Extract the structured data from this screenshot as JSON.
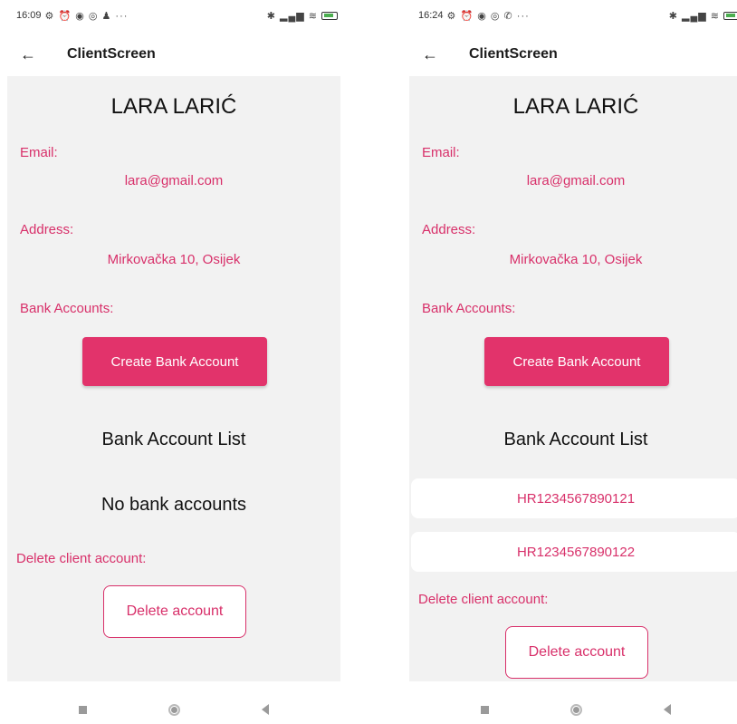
{
  "left_screen": {
    "status": {
      "time": "16:09",
      "left_icons": "⚙ ⏰ ◉ ◎ ♟ ···",
      "right_icons": "✱ ▂▄▆ ≋"
    },
    "app_bar": {
      "back_icon": "←",
      "title": "ClientScreen"
    },
    "client": {
      "name": "LARA LARIĆ",
      "email_label": "Email:",
      "email": "lara@gmail.com",
      "address_label": "Address:",
      "address": "Mirkovačka 10, Osijek",
      "bank_accounts_label": "Bank Accounts:"
    },
    "create_button": "Create Bank Account",
    "list_title": "Bank Account List",
    "empty_text": "No bank accounts",
    "delete_label": "Delete  client account:",
    "delete_button": "Delete account"
  },
  "right_screen": {
    "status": {
      "time": "16:24",
      "left_icons": "⚙ ⏰ ◉ ◎ ✆ ···",
      "right_icons": "✱ ▂▄▆ ≋"
    },
    "app_bar": {
      "back_icon": "←",
      "title": "ClientScreen"
    },
    "client": {
      "name": "LARA LARIĆ",
      "email_label": "Email:",
      "email": "lara@gmail.com",
      "address_label": "Address:",
      "address": "Mirkovačka 10, Osijek",
      "bank_accounts_label": "Bank Accounts:"
    },
    "create_button": "Create Bank Account",
    "list_title": "Bank Account List",
    "accounts": [
      "HR1234567890121",
      "HR1234567890122"
    ],
    "delete_label": "Delete  client account:",
    "delete_button": "Delete account"
  },
  "colors": {
    "accent": "#e2336b",
    "text_pink": "#d8306a",
    "content_bg": "#f2f2f2"
  }
}
